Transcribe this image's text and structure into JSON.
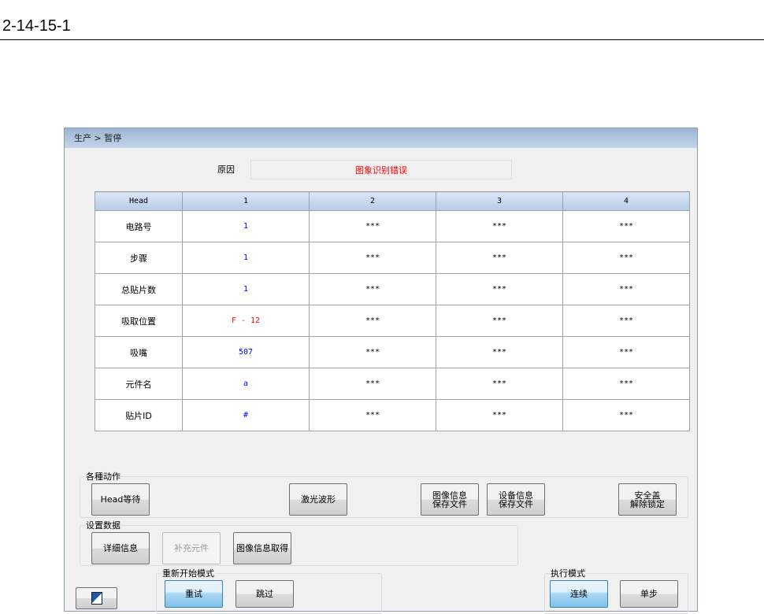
{
  "doc_id": "2-14-15-1",
  "breadcrumb": "生产 > 暂停",
  "reason": {
    "label": "原因",
    "value": "图象识别错误"
  },
  "table": {
    "headers": [
      "Head",
      "1",
      "2",
      "3",
      "4"
    ],
    "rows": [
      {
        "label": "电路号",
        "values": [
          "1",
          "***",
          "***",
          "***"
        ],
        "color": "#0000ff"
      },
      {
        "label": "步骤",
        "values": [
          "1",
          "***",
          "***",
          "***"
        ],
        "color": "#0000ff"
      },
      {
        "label": "总贴片数",
        "values": [
          "1",
          "***",
          "***",
          "***"
        ],
        "color": "#0000ff"
      },
      {
        "label": "吸取位置",
        "values": [
          "F - 12",
          "***",
          "***",
          "***"
        ],
        "color": "#ff0000"
      },
      {
        "label": "吸嘴",
        "values": [
          "507",
          "***",
          "***",
          "***"
        ],
        "color": "#0000ff"
      },
      {
        "label": "元件名",
        "values": [
          "a",
          "***",
          "***",
          "***"
        ],
        "color": "#0000ff"
      },
      {
        "label": "贴片ID",
        "values": [
          "#",
          "***",
          "***",
          "***"
        ],
        "color": "#0000ff"
      }
    ]
  },
  "actions": {
    "label": "各種动作",
    "head_wait": "Head等待",
    "laser": "激光波形",
    "image_save": "图像信息\n保存文件",
    "device_save": "设备信息\n保存文件",
    "safety": "安全盖\n解除锁定"
  },
  "settings": {
    "label": "设置数据",
    "detail": "详细信息",
    "supplement": "补充元件",
    "image_get": "图像信息取得"
  },
  "restart": {
    "label": "重新开始模式",
    "retry": "重试",
    "skip": "跳过"
  },
  "exec": {
    "label": "执行模式",
    "continuous": "连续",
    "step": "单步"
  }
}
